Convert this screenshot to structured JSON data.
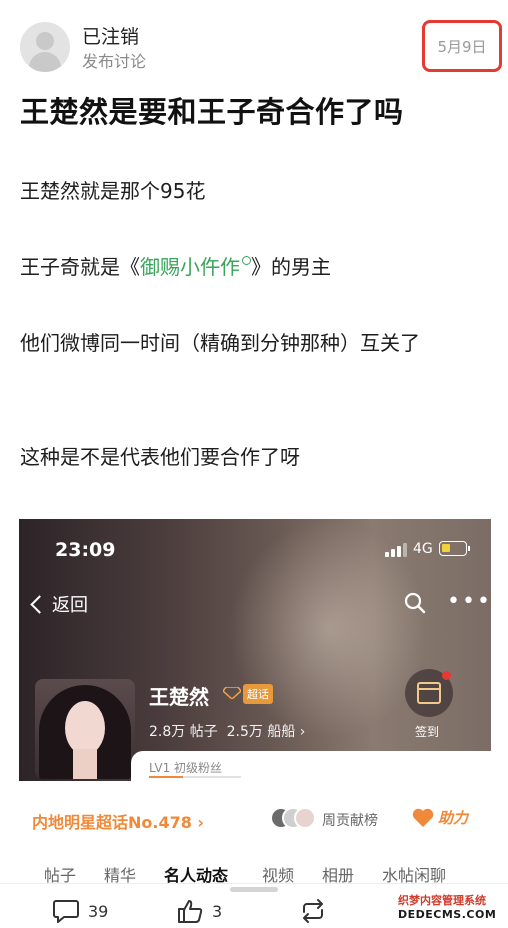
{
  "post": {
    "author": "已注销",
    "subtitle": "发布讨论",
    "date": "5月9日",
    "title": "王楚然是要和王子奇合作了吗",
    "paragraphs": {
      "p1": "王楚然就是那个95花",
      "p2_before": "王子奇就是《",
      "p2_link": "御赐小仵作",
      "p2_after": "》的男主",
      "p3": "他们微博同一时间（精确到分钟那种）互关了",
      "p4": "这种是不是代表他们要合作了呀"
    }
  },
  "embedded": {
    "time": "23:09",
    "network": "4G",
    "back_label": "返回",
    "name": "王楚然",
    "tag": "超话",
    "posts_count": "2.8万 帖子",
    "fans_count": "2.5万 船船 ›",
    "sign_label": "签到",
    "level": "LV1 初级粉丝",
    "level_progress_pct": 37
  },
  "rank": {
    "label": "内地明星超话No.478 ›",
    "contrib_label": "周贡献榜",
    "boost_label": "助力"
  },
  "tabs": [
    "帖子",
    "精华",
    "名人动态",
    "视频",
    "相册",
    "水帖闲聊"
  ],
  "actions": {
    "comments": "39",
    "likes": "3"
  },
  "watermark": {
    "line1": "织梦内容管理系统",
    "line2": "DEDECMS.COM"
  },
  "colors": {
    "accent_link": "#3aa55a",
    "highlight_border": "#e43a32",
    "orange": "#f08a3a"
  }
}
